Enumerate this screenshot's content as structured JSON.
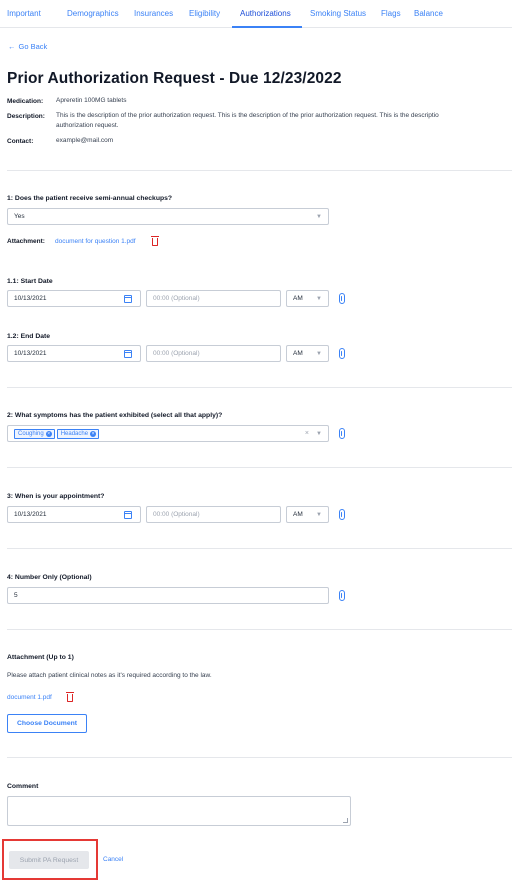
{
  "tabs": [
    {
      "label": "Important"
    },
    {
      "label": "Demographics"
    },
    {
      "label": "Insurances"
    },
    {
      "label": "Eligibility"
    },
    {
      "label": "Authorizations"
    },
    {
      "label": "Smoking Status"
    },
    {
      "label": "Flags"
    },
    {
      "label": "Balance"
    }
  ],
  "active_tab": "Authorizations",
  "back": {
    "label": "Go Back"
  },
  "title": "Prior Authorization Request - Due 12/23/2022",
  "meta": {
    "medication_label": "Medication:",
    "medication_value": "Apreretin 100MG tablets",
    "description_label": "Description:",
    "description_line1": "This is the description of the prior authorization request. This is the description of the prior authorization request. This is the descriptio",
    "description_line2": "authorization request.",
    "contact_label": "Contact:",
    "contact_value": "example@mail.com"
  },
  "q1": {
    "label": "1: Does the patient receive semi-annual checkups?",
    "value": "Yes",
    "attachment_label": "Attachment:",
    "attachment_file": "document for question 1.pdf"
  },
  "q1_1": {
    "label": "1.1: Start Date",
    "date": "10/13/2021",
    "time_placeholder": "00:00 (Optional)",
    "ampm": "AM"
  },
  "q1_2": {
    "label": "1.2: End Date",
    "date": "10/13/2021",
    "time_placeholder": "00:00 (Optional)",
    "ampm": "AM"
  },
  "q2": {
    "label": "2: What symptoms has the patient exhibited (select all that apply)?",
    "chips": [
      "Coughing",
      "Headache"
    ]
  },
  "q3": {
    "label": "3: When is your appointment?",
    "date": "10/13/2021",
    "time_placeholder": "00:00 (Optional)",
    "ampm": "AM"
  },
  "q4": {
    "label": "4: Number Only (Optional)",
    "value": "5"
  },
  "attachment": {
    "title": "Attachment (Up to 1)",
    "note": "Please attach patient clinical notes as it's required according to the law.",
    "file": "document 1.pdf",
    "choose_button": "Choose Document"
  },
  "comment": {
    "label": "Comment",
    "value": ""
  },
  "actions": {
    "submit": "Submit PA Request",
    "cancel": "Cancel"
  },
  "colors": {
    "accent": "#3b82f6",
    "danger": "#dc2626",
    "highlight": "#e53935"
  },
  "icons": [
    "arrow-left-icon",
    "calendar-icon",
    "paperclip-icon",
    "trash-icon",
    "chevron-down-icon",
    "close-icon"
  ]
}
